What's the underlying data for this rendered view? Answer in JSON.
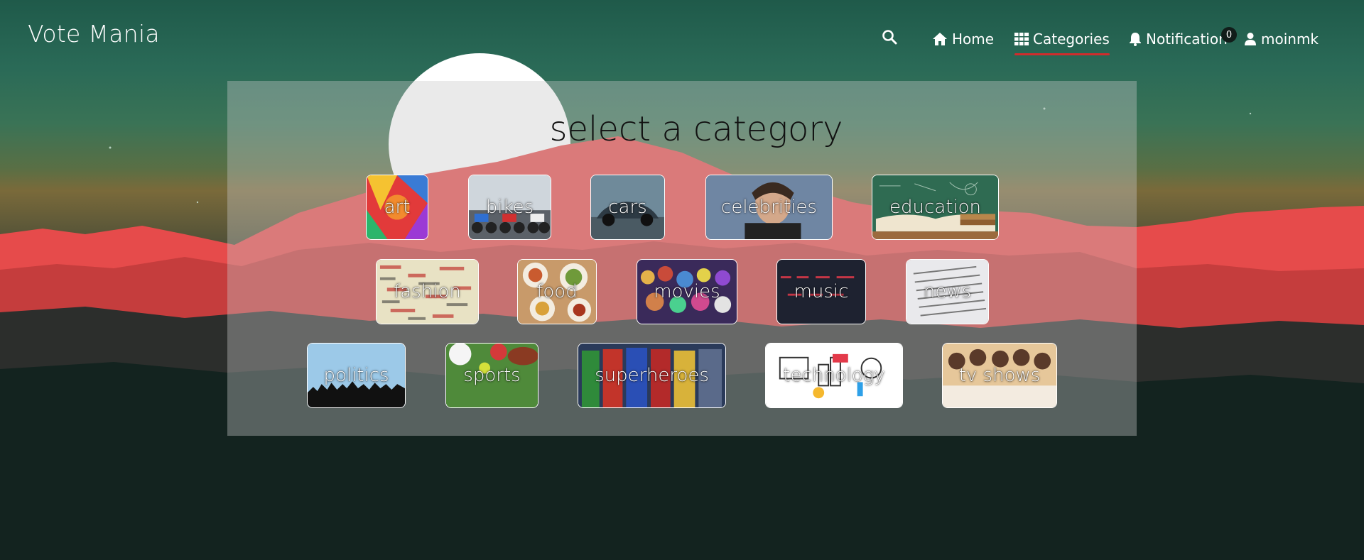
{
  "brand": "Vote Mania",
  "nav": {
    "home": "Home",
    "categories": "Categories",
    "notification": "Notification",
    "notification_count": "0",
    "user": "moinmk",
    "active": "Categories"
  },
  "icons": {
    "search": "search-icon",
    "home": "home-icon",
    "categories": "grid-icon",
    "notification": "bell-icon",
    "user": "user-icon"
  },
  "colors": {
    "accent_underline": "#d12c2c",
    "mountains": "#e84a4a",
    "brand_text": "#ffffff"
  },
  "main": {
    "title": "select a category",
    "categories": [
      {
        "label": "art"
      },
      {
        "label": "bikes"
      },
      {
        "label": "cars"
      },
      {
        "label": "celebrities"
      },
      {
        "label": "education"
      },
      {
        "label": "fashion"
      },
      {
        "label": "food"
      },
      {
        "label": "movies"
      },
      {
        "label": "music"
      },
      {
        "label": "news"
      },
      {
        "label": "politics"
      },
      {
        "label": "sports"
      },
      {
        "label": "superheroes"
      },
      {
        "label": "technology"
      },
      {
        "label": "tv shows"
      }
    ]
  }
}
